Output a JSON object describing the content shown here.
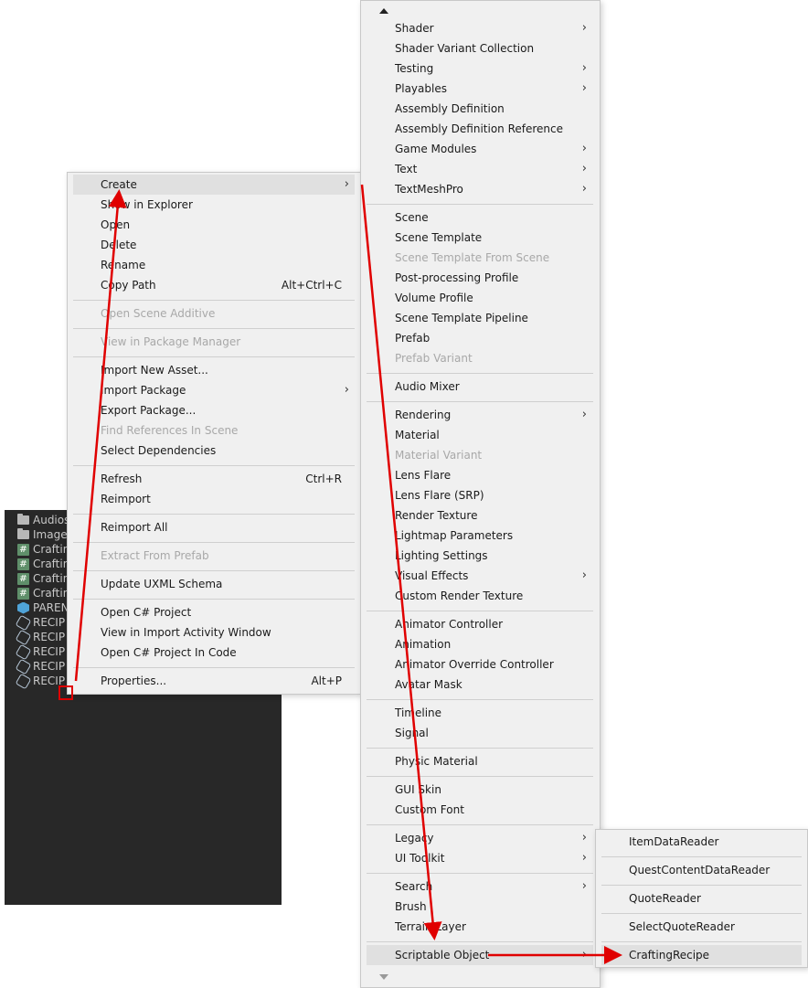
{
  "project_panel": {
    "items": [
      {
        "icon": "folder-icon",
        "label": "Audios"
      },
      {
        "icon": "folder-icon",
        "label": "Images"
      },
      {
        "icon": "script-icon",
        "label": "Craftin"
      },
      {
        "icon": "script-icon",
        "label": "Craftin"
      },
      {
        "icon": "script-icon",
        "label": "Craftin"
      },
      {
        "icon": "script-icon",
        "label": "Craftin"
      },
      {
        "icon": "prefab-icon",
        "label": "PAREN"
      },
      {
        "icon": "scriptable-object-icon",
        "label": "RECIP"
      },
      {
        "icon": "scriptable-object-icon",
        "label": "RECIP"
      },
      {
        "icon": "scriptable-object-icon",
        "label": "RECIP"
      },
      {
        "icon": "scriptable-object-icon",
        "label": "RECIP"
      },
      {
        "icon": "scriptable-object-icon",
        "label": "RECIP"
      }
    ]
  },
  "context_menu": {
    "items": {
      "create": "Create",
      "show_in_explorer": "Show in Explorer",
      "open": "Open",
      "delete": "Delete",
      "rename": "Rename",
      "copy_path": "Copy Path",
      "copy_path_shortcut": "Alt+Ctrl+C",
      "open_scene_additive": "Open Scene Additive",
      "view_in_package_manager": "View in Package Manager",
      "import_new_asset": "Import New Asset...",
      "import_package": "Import Package",
      "export_package": "Export Package...",
      "find_references": "Find References In Scene",
      "select_dependencies": "Select Dependencies",
      "refresh": "Refresh",
      "refresh_shortcut": "Ctrl+R",
      "reimport": "Reimport",
      "reimport_all": "Reimport All",
      "extract_from_prefab": "Extract From Prefab",
      "update_uxml": "Update UXML Schema",
      "open_csharp": "Open C# Project",
      "view_import_activity": "View in Import Activity Window",
      "open_csharp_code": "Open C# Project In Code",
      "properties": "Properties...",
      "properties_shortcut": "Alt+P"
    }
  },
  "create_menu": {
    "items": {
      "shader": "Shader",
      "shader_variant_collection": "Shader Variant Collection",
      "testing": "Testing",
      "playables": "Playables",
      "assembly_definition": "Assembly Definition",
      "assembly_definition_reference": "Assembly Definition Reference",
      "game_modules": "Game Modules",
      "text": "Text",
      "textmeshpro": "TextMeshPro",
      "scene": "Scene",
      "scene_template": "Scene Template",
      "scene_template_from_scene": "Scene Template From Scene",
      "post_processing_profile": "Post-processing Profile",
      "volume_profile": "Volume Profile",
      "scene_template_pipeline": "Scene Template Pipeline",
      "prefab": "Prefab",
      "prefab_variant": "Prefab Variant",
      "audio_mixer": "Audio Mixer",
      "rendering": "Rendering",
      "material": "Material",
      "material_variant": "Material Variant",
      "lens_flare": "Lens Flare",
      "lens_flare_srp": "Lens Flare (SRP)",
      "render_texture": "Render Texture",
      "lightmap_parameters": "Lightmap Parameters",
      "lighting_settings": "Lighting Settings",
      "visual_effects": "Visual Effects",
      "custom_render_texture": "Custom Render Texture",
      "animator_controller": "Animator Controller",
      "animation": "Animation",
      "animator_override_controller": "Animator Override Controller",
      "avatar_mask": "Avatar Mask",
      "timeline": "Timeline",
      "signal": "Signal",
      "physic_material": "Physic Material",
      "gui_skin": "GUI Skin",
      "custom_font": "Custom Font",
      "legacy": "Legacy",
      "ui_toolkit": "UI Toolkit",
      "search": "Search",
      "brush": "Brush",
      "terrain_layer": "Terrain Layer",
      "scriptable_object": "Scriptable Object"
    }
  },
  "scriptable_menu": {
    "items": {
      "item_data_reader": "ItemDataReader",
      "quest_content_data_reader": "QuestContentDataReader",
      "quote_reader": "QuoteReader",
      "select_quote_reader": "SelectQuoteReader",
      "crafting_recipe": "CraftingRecipe"
    }
  },
  "glyphs": {
    "submenu_arrow": "›"
  },
  "colors": {
    "annotation": "#e00000",
    "highlight": "#e0e0e0",
    "disabled_text": "#a8a8a8"
  }
}
